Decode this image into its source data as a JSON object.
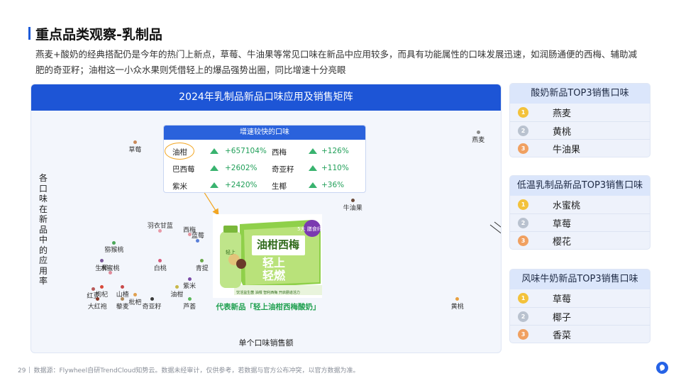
{
  "title": "重点品类观察-乳制品",
  "subtitle": "燕麦+酸奶的经典搭配仍是今年的热门上新点，草莓、牛油果等常见口味在新品中应用较多，而具有功能属性的口味发展迅速，如润肠通便的西梅、辅助减肥的奇亚籽；油柑这一小众水果则凭借轻上的爆品强势出圈，同比增速十分亮眼",
  "main": {
    "header": "2024年乳制品新品口味应用及销售矩阵",
    "y_label": "各口味在新品中的应用率",
    "x_label": "单个口味销售额"
  },
  "chart_data": {
    "type": "scatter",
    "xlabel": "单个口味销售额",
    "ylabel": "各口味在新品中的应用率",
    "points": [
      {
        "label": "燕麦",
        "x": 98,
        "y": 98,
        "color": "#8a8a8a"
      },
      {
        "label": "草莓",
        "x": 16,
        "y": 93,
        "color": "#c98a5a"
      },
      {
        "label": "牛油果",
        "x": 68,
        "y": 64,
        "color": "#6a4a3a"
      },
      {
        "label": "羽衣甘蓝",
        "x": 22,
        "y": 49,
        "color": "#e79aa8"
      },
      {
        "label": "西梅",
        "x": 29,
        "y": 47,
        "color": "#e5959f"
      },
      {
        "label": "蓝莓",
        "x": 31,
        "y": 44,
        "color": "#5a7fd8"
      },
      {
        "label": "猕猴桃",
        "x": 11,
        "y": 43,
        "color": "#4ca85a"
      },
      {
        "label": "生椰",
        "x": 8,
        "y": 34,
        "color": "#7b5a9a"
      },
      {
        "label": "白桃",
        "x": 22,
        "y": 34,
        "color": "#d95a7a"
      },
      {
        "label": "青提",
        "x": 32,
        "y": 34,
        "color": "#6aa84a"
      },
      {
        "label": "水蜜桃",
        "x": 10,
        "y": 28,
        "color": "#e08a9a"
      },
      {
        "label": "紫米",
        "x": 29,
        "y": 25,
        "color": "#7a4aa8"
      },
      {
        "label": "枸杞",
        "x": 8,
        "y": 21,
        "color": "#d84a3a"
      },
      {
        "label": "山楂",
        "x": 13,
        "y": 21,
        "color": "#c84a4a"
      },
      {
        "label": "油柑",
        "x": 26,
        "y": 21,
        "color": "#c8b84a"
      },
      {
        "label": "红豆",
        "x": 6,
        "y": 20,
        "color": "#b85a5a"
      },
      {
        "label": "枇杷",
        "x": 16,
        "y": 17,
        "color": "#e0a050"
      },
      {
        "label": "大红袍",
        "x": 7,
        "y": 15,
        "color": "#8a3a2a"
      },
      {
        "label": "藜麦",
        "x": 13,
        "y": 15,
        "color": "#b08a5a"
      },
      {
        "label": "奇亚籽",
        "x": 20,
        "y": 15,
        "color": "#3a3a3a"
      },
      {
        "label": "芦荟",
        "x": 29,
        "y": 15,
        "color": "#5ab85a"
      },
      {
        "label": "黄桃",
        "x": 93,
        "y": 15,
        "color": "#e8a040"
      }
    ]
  },
  "growth": {
    "header": "增速较快的口味",
    "items": [
      {
        "name": "油柑",
        "value": "+657104%"
      },
      {
        "name": "西梅",
        "value": "+126%"
      },
      {
        "name": "巴西莓",
        "value": "+2602%"
      },
      {
        "name": "奇亚籽",
        "value": "+110%"
      },
      {
        "name": "紫米",
        "value": "+2420%"
      },
      {
        "name": "生椰",
        "value": "+36%"
      }
    ],
    "arrow_color": "#39b36f"
  },
  "product": {
    "caption": "代表新品「轻上油柑西梅酸奶」",
    "box_text_1": "油柑西梅",
    "box_text_2": "轻上",
    "box_text_3": "轻燃",
    "badge": "5大\n膳食纤维",
    "bottle_text": "轻上",
    "strip_text": "饮活益生菌 油柑 智利西梅 开启肠道活力"
  },
  "side_panels": [
    {
      "title": "酸奶新品TOP3销售口味",
      "items": [
        "燕麦",
        "黄桃",
        "牛油果"
      ]
    },
    {
      "title": "低温乳制品新品TOP3销售口味",
      "items": [
        "水蜜桃",
        "草莓",
        "樱花"
      ]
    },
    {
      "title": "风味牛奶新品TOP3销售口味",
      "items": [
        "草莓",
        "椰子",
        "香菜"
      ]
    }
  ],
  "medals": [
    "1",
    "2",
    "3"
  ],
  "medal_colors": [
    "#f3c23b",
    "#b9c2cf",
    "#f0a060"
  ],
  "footer": {
    "page": "29",
    "source": "数据源：Flywheel自研TrendCloud知势云。数据未经审计，仅供参考，若数据与官方公布冲突，以官方数据为准。"
  }
}
